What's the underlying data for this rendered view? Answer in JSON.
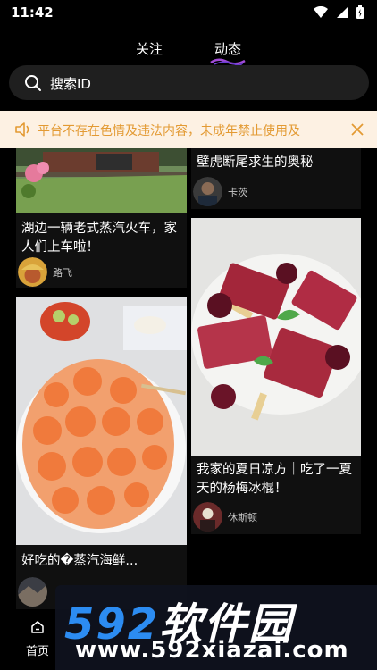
{
  "status_bar": {
    "time": "11:42"
  },
  "tabs": {
    "follow": "关注",
    "feed": "动态"
  },
  "search": {
    "placeholder": "搜索ID"
  },
  "notice": {
    "text": "平台不存在色情及违法内容，未成年禁止使用及"
  },
  "cards": [
    {
      "title": "湖边一辆老式蒸汽火车，家人们上车啦！",
      "author": "路飞"
    },
    {
      "title": "壁虎断尾求生的奥秘",
      "author": "卡茨"
    },
    {
      "title": "我家的夏日凉方｜吃了一夏天的杨梅冰棍！",
      "author": "休斯顿"
    },
    {
      "title": "好吃的�蒸汽海鲜...",
      "author": ""
    }
  ],
  "bottom_nav": {
    "home": "首页"
  },
  "watermark": {
    "logo_num": "592",
    "logo_cn": "软件园",
    "url": "www.592xiazai.com"
  },
  "colors": {
    "notice_bg": "#fdf1e3",
    "notice_text": "#e39a33",
    "search_bg": "#1f1f1f",
    "watermark_blue": "#2c8cf2"
  }
}
